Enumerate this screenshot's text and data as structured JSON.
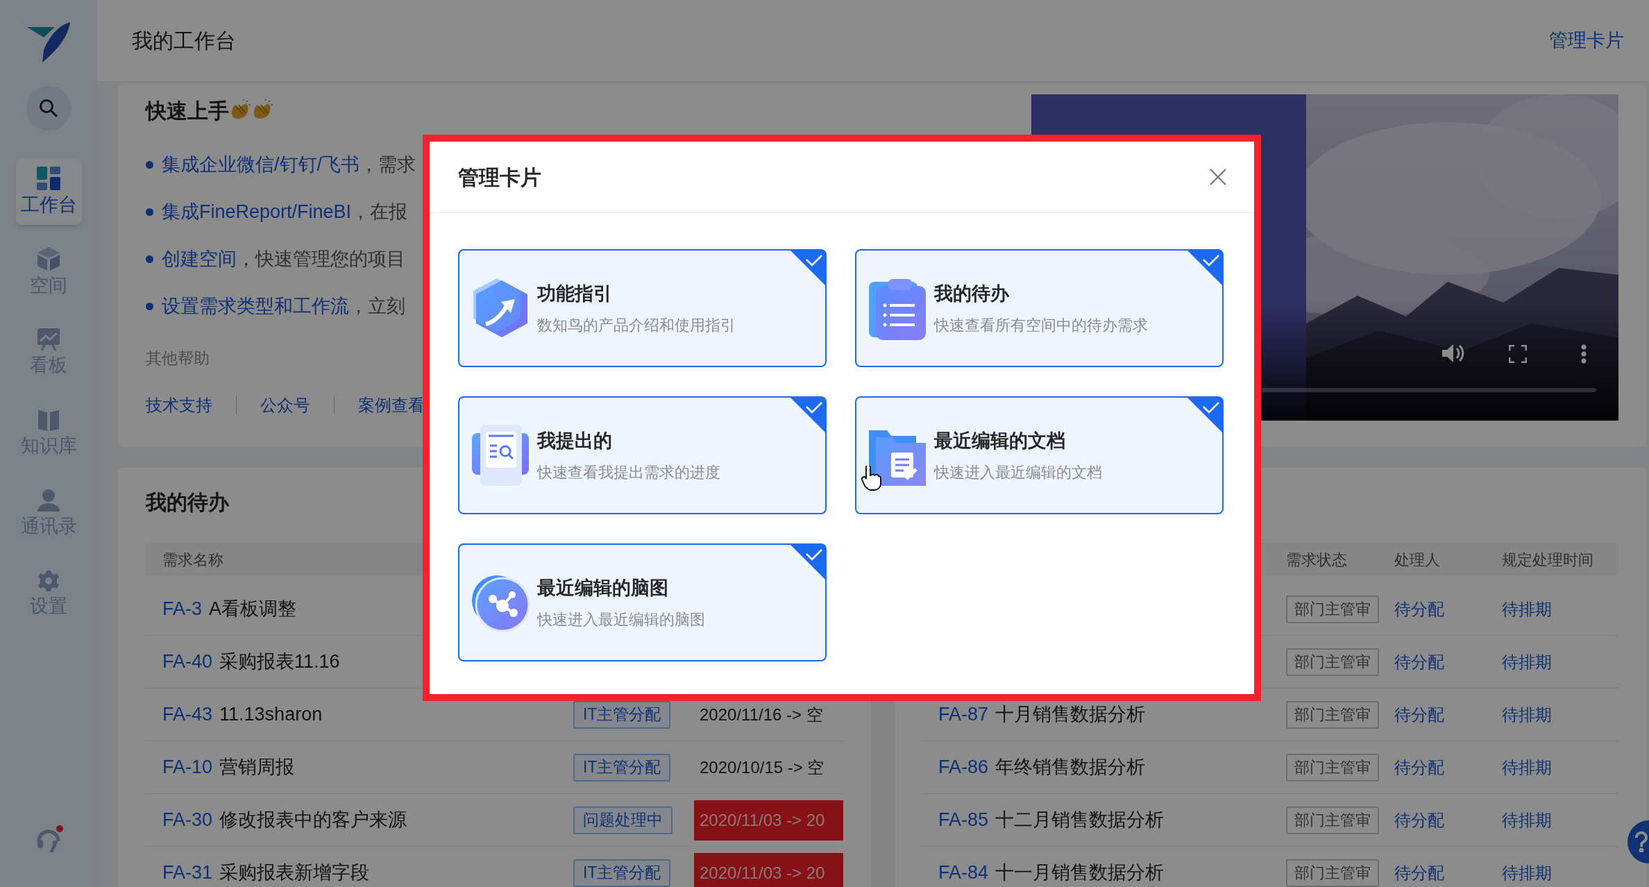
{
  "sidebar": {
    "items": [
      {
        "label": "工作台",
        "selected": true
      },
      {
        "label": "空间",
        "selected": false
      },
      {
        "label": "看板",
        "selected": false
      },
      {
        "label": "知识库",
        "selected": false
      },
      {
        "label": "通讯录",
        "selected": false
      },
      {
        "label": "设置",
        "selected": false
      }
    ]
  },
  "header": {
    "title": "我的工作台",
    "action": "管理卡片"
  },
  "video": {
    "progress": {
      "level": 0.0
    }
  },
  "quick_start": {
    "title": "快速上手",
    "items": [
      {
        "link": "集成企业微信/钉钉/飞书",
        "text": "，需求"
      },
      {
        "link": "集成FineReport/FineBI",
        "text": "，在报"
      },
      {
        "link": "创建空间",
        "text": "，快速管理您的项目"
      },
      {
        "link": "设置需求类型和工作流",
        "text": "，立刻"
      }
    ],
    "help_title": "其他帮助",
    "help_links": [
      "技术支持",
      "公众号",
      "案例查看"
    ]
  },
  "todo_left": {
    "title": "我的待办",
    "columns": [
      "需求名称"
    ],
    "rows": [
      {
        "id": "FA-3",
        "name": "A看板调整"
      },
      {
        "id": "FA-40",
        "name": "采购报表11.16"
      },
      {
        "id": "FA-43",
        "name": "11.13sharon",
        "status": "IT主管分配",
        "date": "2020/11/16 -> 空",
        "overdue": false
      },
      {
        "id": "FA-10",
        "name": "营销周报",
        "status": "IT主管分配",
        "date": "2020/10/15 -> 空",
        "overdue": false
      },
      {
        "id": "FA-30",
        "name": "修改报表中的客户来源",
        "status": "问题处理中",
        "date": "2020/11/03 -> 20",
        "overdue": true
      },
      {
        "id": "FA-31",
        "name": "采购报表新增字段",
        "status": "IT主管分配",
        "date": "2020/11/03 -> 20",
        "overdue": true
      }
    ]
  },
  "todo_right": {
    "columns": [
      "需求状态",
      "处理人",
      "规定处理时间"
    ],
    "rows": [
      {
        "status": "部门主管审",
        "handler": "待分配",
        "deadline": "待排期"
      },
      {
        "status": "部门主管审",
        "handler": "待分配",
        "deadline": "待排期"
      },
      {
        "id": "FA-87",
        "name": "十月销售数据分析",
        "status": "部门主管审",
        "handler": "待分配",
        "deadline": "待排期"
      },
      {
        "id": "FA-86",
        "name": "年终销售数据分析",
        "status": "部门主管审",
        "handler": "待分配",
        "deadline": "待排期"
      },
      {
        "id": "FA-85",
        "name": "十二月销售数据分析",
        "status": "部门主管审",
        "handler": "待分配",
        "deadline": "待排期"
      },
      {
        "id": "FA-84",
        "name": "十一月销售数据分析",
        "status": "部门主管审",
        "handler": "待分配",
        "deadline": "待排期"
      }
    ]
  },
  "dialog": {
    "title": "管理卡片",
    "cards": [
      {
        "title": "功能指引",
        "description": "数知鸟的产品介绍和使用指引",
        "checked": true
      },
      {
        "title": "我的待办",
        "description": "快速查看所有空间中的待办需求",
        "checked": true
      },
      {
        "title": "我提出的",
        "description": "快速查看我提出需求的进度",
        "checked": true
      },
      {
        "title": "最近编辑的文档",
        "description": "快速进入最近编辑的文档",
        "checked": true
      },
      {
        "title": "最近编辑的脑图",
        "description": "快速进入最近编辑的脑图",
        "checked": true
      }
    ]
  }
}
